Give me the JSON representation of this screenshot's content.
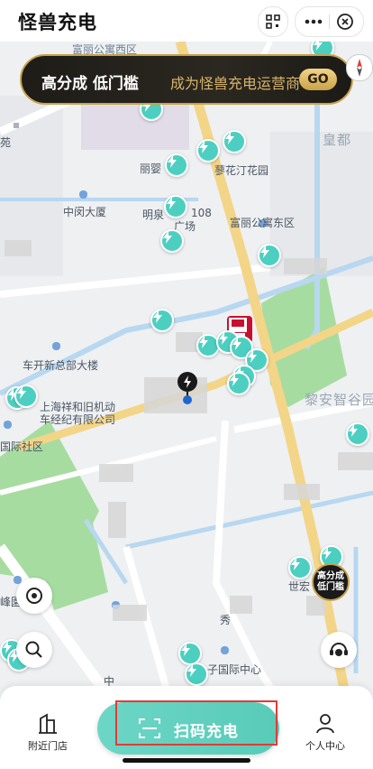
{
  "header": {
    "title": "怪兽充电"
  },
  "banner": {
    "highlight": "高分成 低门槛",
    "slogan": "成为怪兽充电运营商",
    "go": "GO"
  },
  "map_labels": {
    "l1": "富丽公寓西区",
    "l2": "皇都",
    "l3": "丽婴",
    "l4": "蓼花汀花园",
    "l5": "中闵大厦",
    "l6": "明泉",
    "l7": "108",
    "l8": "广场",
    "l9": "富丽公寓东区",
    "l10": "车开新总部大楼",
    "l11": "上海祥和旧机动车经纪有限公司",
    "l12": "黎安智谷园",
    "l13": "国际社区",
    "l14": "峰園",
    "l15": "世宏",
    "l16": "秀",
    "l17": "子国际中心",
    "l18": "中",
    "l19": "苑"
  },
  "promo_bubble": {
    "line1": "高分成",
    "line2": "低门槛"
  },
  "bottom_nav": {
    "nearby": "附近门店",
    "scan": "扫码充电",
    "profile": "个人中心"
  },
  "icons": {
    "pin": "lightning-icon",
    "locate": "locate-icon",
    "search": "search-icon",
    "service": "customer-service-icon"
  },
  "colors": {
    "accent": "#58cbb8",
    "pin": "#4ccfc1",
    "gold": "#c7a24e"
  }
}
